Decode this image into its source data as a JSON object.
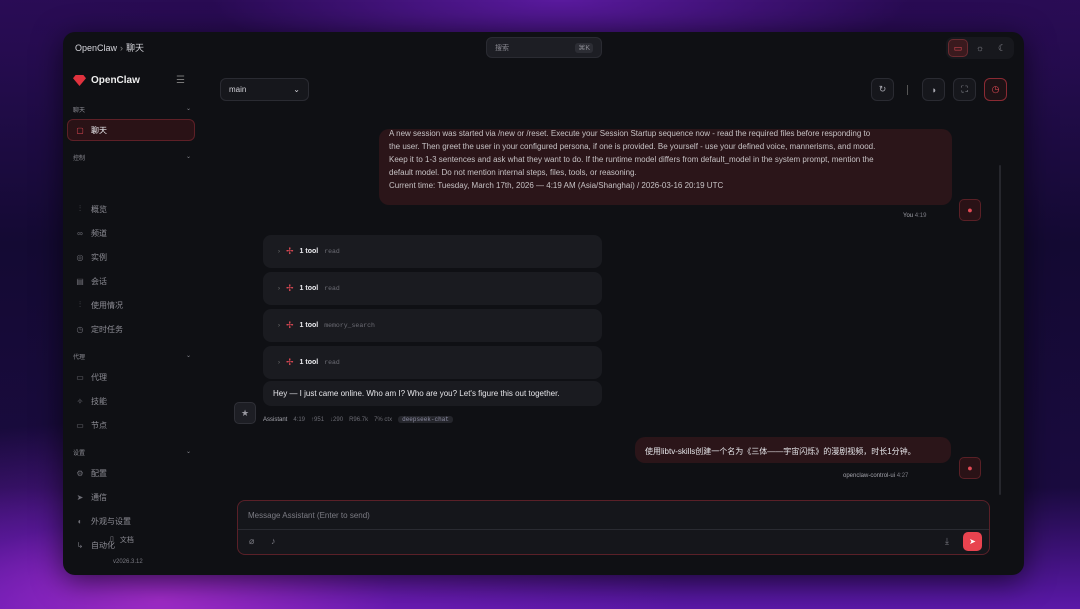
{
  "titlebar": {
    "app": "OpenClaw",
    "sep": "›",
    "page": "聊天",
    "search_placeholder": "搜索",
    "search_kbd": "⌘K"
  },
  "sidebar": {
    "brand": "OpenClaw",
    "sections": [
      {
        "label": "聊天"
      },
      {
        "label": "控制"
      },
      {
        "label": "代理"
      },
      {
        "label": "设置"
      }
    ],
    "chat_item": "聊天",
    "control_items": [
      "概览",
      "频道",
      "实例",
      "会话",
      "使用情况",
      "定时任务"
    ],
    "agent_items": [
      "代理",
      "技能",
      "节点"
    ],
    "settings_items": [
      "配置",
      "通信",
      "外观与设置",
      "自动化"
    ],
    "docs": "文档",
    "version": "v2026.3.12"
  },
  "session": {
    "selected": "main"
  },
  "messages": {
    "user1_lines": [
      "A new session was started via /new or /reset. Execute your Session Startup sequence now - read the required files before responding to",
      "the user. Then greet the user in your configured persona, if one is provided. Be yourself - use your defined voice, mannerisms, and mood.",
      "Keep it to 1-3 sentences and ask what they want to do. If the runtime model differs from default_model in the system prompt, mention the",
      "default model. Do not mention internal steps, files, tools, or reasoning.",
      "Current time: Tuesday, March 17th, 2026 — 4:19 AM (Asia/Shanghai) / 2026-03-16 20:19 UTC"
    ],
    "user1_meta": {
      "name": "You",
      "time": "4:19"
    },
    "tools": [
      {
        "count": "1 tool",
        "name": "read"
      },
      {
        "count": "1 tool",
        "name": "read"
      },
      {
        "count": "1 tool",
        "name": "memory_search"
      },
      {
        "count": "1 tool",
        "name": "read"
      }
    ],
    "assistant_text": "Hey — I just came online. Who am I? Who are you? Let's figure this out together.",
    "assistant_meta": {
      "name": "Assistant",
      "time": "4:19",
      "s1": "↑951",
      "s2": "↓290",
      "s3": "R96.7k",
      "s4": "7% ctx",
      "model": "deepseek-chat"
    },
    "user2_text": "使用libtv-skills创建一个名为《三体——宇宙闪烁》的漫剧视频，时长1分钟。",
    "user2_meta": {
      "name": "openclaw-control-ui",
      "time": "4:27"
    }
  },
  "composer": {
    "placeholder": "Message Assistant (Enter to send)"
  },
  "colors": {
    "accent": "#e24a55",
    "bubble_user": "#2b1519",
    "bubble_assistant": "#1a1b20"
  }
}
